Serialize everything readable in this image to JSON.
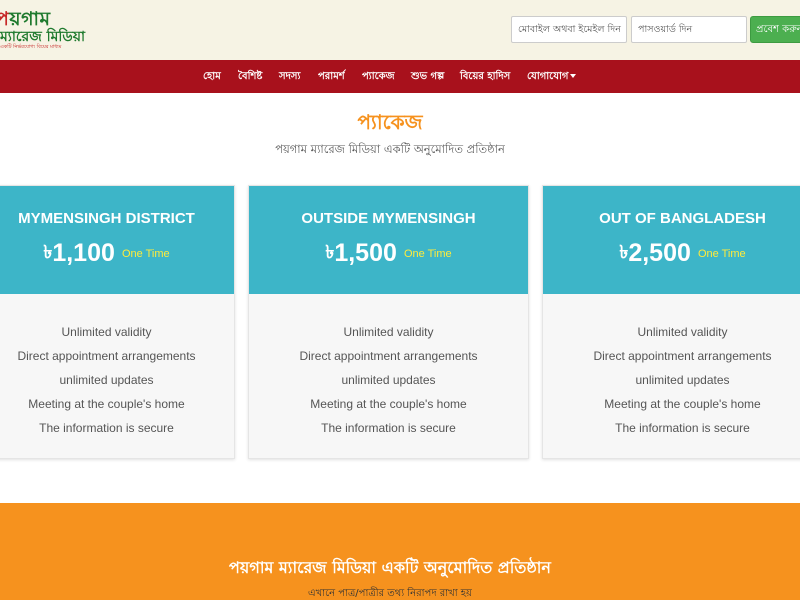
{
  "logo": {
    "brand_first": "প",
    "brand_rest": "য়গাম",
    "subtitle": "ম্যারেজ মিডিয়া",
    "tagline": "একটি নির্ভরযোগ্য বিয়ের মাধ্যম"
  },
  "login": {
    "mobile_placeholder": "মোবাইল অথবা ইমেইল দিন",
    "password_placeholder": "পাসওয়ার্ড দিন",
    "submit_label": "প্রবেশ করুন"
  },
  "nav": {
    "items": [
      "হোম",
      "বৈশিষ্ট",
      "সদস্য",
      "পরামর্শ",
      "প্যাকেজ",
      "শুভ গল্প",
      "বিয়ের হাদিস",
      "যোগাযোগ"
    ]
  },
  "packages_section": {
    "title": "প্যাকেজ",
    "subtitle": "পয়গাম ম্যারেজ মিডিয়া একটি অনুমোদিত প্রতিষ্ঠান"
  },
  "packages": [
    {
      "name": "MYMENSINGH DISTRICT",
      "currency": "৳",
      "price": "1,100",
      "term": "One Time",
      "features": [
        "Unlimited validity",
        "Direct appointment arrangements",
        "unlimited updates",
        "Meeting at the couple's home",
        "The information is secure"
      ]
    },
    {
      "name": "OUTSIDE MYMENSINGH",
      "currency": "৳",
      "price": "1,500",
      "term": "One Time",
      "features": [
        "Unlimited validity",
        "Direct appointment arrangements",
        "unlimited updates",
        "Meeting at the couple's home",
        "The information is secure"
      ]
    },
    {
      "name": "OUT OF BANGLADESH",
      "currency": "৳",
      "price": "2,500",
      "term": "One Time",
      "features": [
        "Unlimited validity",
        "Direct appointment arrangements",
        "unlimited updates",
        "Meeting at the couple's home",
        "The information is secure"
      ]
    }
  ],
  "banner": {
    "title": "পয়গাম ম্যারেজ মিডিয়া একটি অনুমোদিত প্রতিষ্ঠান",
    "subtitle": "এখানে পাত্র/পাত্রীর তথ্য নিরাপদ রাখা হয়"
  },
  "colors": {
    "nav_bg": "#a8111c",
    "card_header": "#3db5c8",
    "accent_orange": "#f6921e",
    "login_button": "#4caf50",
    "price_term": "#ffeb3b"
  }
}
